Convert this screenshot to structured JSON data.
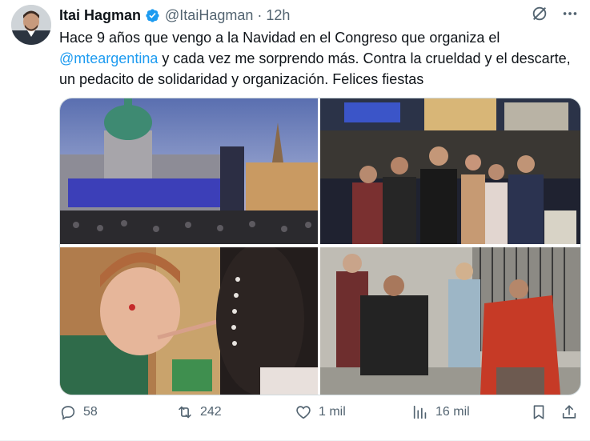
{
  "author": {
    "name": "Itai Hagman",
    "handle": "@ItaiHagman",
    "separator": "·",
    "time": "12h"
  },
  "tweet": {
    "text_before": "Hace 9 años que vengo a la Navidad en el Congreso que organiza el",
    "mention": "@mteargentina",
    "text_after": "y cada vez me sorprendo más. Contra la crueldad y el descarte, un pedacito de solidaridad y organización. Felices fiestas"
  },
  "actions": {
    "replies": "58",
    "retweets": "242",
    "likes": "1 mil",
    "views": "16 mil"
  },
  "colors": {
    "accent": "#1d9bf0",
    "muted": "#536471",
    "text": "#0f1419"
  },
  "icons": [
    "verified-badge-icon",
    "grok-icon",
    "more-icon",
    "reply-icon",
    "retweet-icon",
    "like-icon",
    "views-icon",
    "bookmark-icon",
    "share-icon"
  ]
}
